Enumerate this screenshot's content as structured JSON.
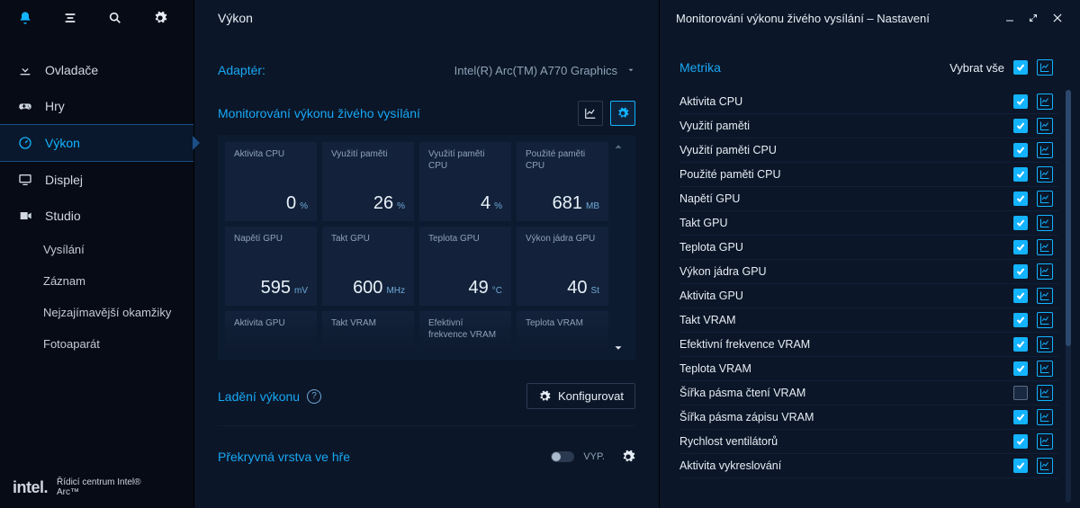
{
  "sidebar": {
    "items": [
      {
        "label": "Ovladače"
      },
      {
        "label": "Hry"
      },
      {
        "label": "Výkon"
      },
      {
        "label": "Displej"
      },
      {
        "label": "Studio"
      }
    ],
    "studio_sub": [
      {
        "label": "Vysílání"
      },
      {
        "label": "Záznam"
      },
      {
        "label": "Nejzajímavější okamžiky"
      },
      {
        "label": "Fotoaparát"
      }
    ],
    "brand_text": "Řídicí centrum Intel® Arc™",
    "brand_logo": "intel."
  },
  "mid": {
    "title": "Výkon",
    "adapter_label": "Adaptér:",
    "adapter_value": "Intel(R) Arc(TM) A770 Graphics",
    "monitor_heading": "Monitorování výkonu živého vysílání",
    "tuning_heading": "Ladění výkonu",
    "configure_btn": "Konfigurovat",
    "overlay_heading": "Překryvná vrstva ve hře",
    "overlay_state": "VYP.",
    "tiles": [
      {
        "label": "Aktivita CPU",
        "value": "0",
        "unit": "%"
      },
      {
        "label": "Využití paměti",
        "value": "26",
        "unit": "%"
      },
      {
        "label": "Využití paměti CPU",
        "value": "4",
        "unit": "%"
      },
      {
        "label": "Použité paměti CPU",
        "value": "681",
        "unit": "MB"
      },
      {
        "label": "Napětí GPU",
        "value": "595",
        "unit": "mV"
      },
      {
        "label": "Takt GPU",
        "value": "600",
        "unit": "MHz"
      },
      {
        "label": "Teplota GPU",
        "value": "49",
        "unit": "°C"
      },
      {
        "label": "Výkon jádra GPU",
        "value": "40",
        "unit": "St"
      }
    ],
    "tiles_partial": [
      {
        "label": "Aktivita GPU"
      },
      {
        "label": "Takt VRAM"
      },
      {
        "label": "Efektivní frekvence VRAM"
      },
      {
        "label": "Teplota VRAM"
      }
    ]
  },
  "right": {
    "title": "Monitorování výkonu živého vysílání – Nastavení",
    "metrics_heading": "Metrika",
    "select_all": "Vybrat vše",
    "metrics": [
      {
        "label": "Aktivita CPU",
        "on": true
      },
      {
        "label": "Využití paměti",
        "on": true
      },
      {
        "label": "Využití paměti CPU",
        "on": true
      },
      {
        "label": "Použité paměti CPU",
        "on": true
      },
      {
        "label": "Napětí GPU",
        "on": true
      },
      {
        "label": "Takt GPU",
        "on": true
      },
      {
        "label": "Teplota GPU",
        "on": true
      },
      {
        "label": "Výkon jádra GPU",
        "on": true
      },
      {
        "label": "Aktivita GPU",
        "on": true
      },
      {
        "label": "Takt VRAM",
        "on": true
      },
      {
        "label": "Efektivní frekvence VRAM",
        "on": true
      },
      {
        "label": "Teplota VRAM",
        "on": true
      },
      {
        "label": "Šířka pásma čtení VRAM",
        "on": false
      },
      {
        "label": "Šířka pásma zápisu VRAM",
        "on": true
      },
      {
        "label": "Rychlost ventilátorů",
        "on": true
      },
      {
        "label": "Aktivita vykreslování",
        "on": true
      }
    ]
  }
}
